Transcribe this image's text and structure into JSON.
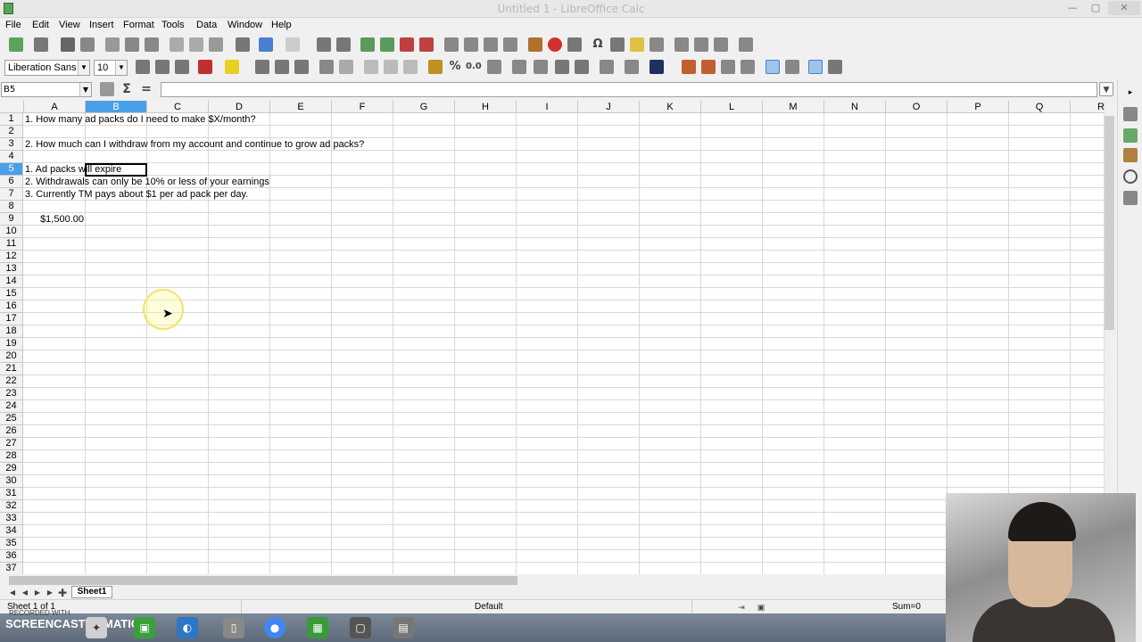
{
  "window": {
    "title": "Untitled 1 - LibreOffice Calc",
    "min": "—",
    "max": "▢",
    "close": "✕"
  },
  "menu": [
    "File",
    "Edit",
    "View",
    "Insert",
    "Format",
    "Tools",
    "Data",
    "Window",
    "Help"
  ],
  "format_bar": {
    "font_name": "Liberation Sans",
    "font_size": "10"
  },
  "formula_bar": {
    "name_box": "B5",
    "input": ""
  },
  "columns": [
    "A",
    "B",
    "C",
    "D",
    "E",
    "F",
    "G",
    "H",
    "I",
    "J",
    "K",
    "L",
    "M",
    "N",
    "O",
    "P",
    "Q",
    "R"
  ],
  "selected_column": "B",
  "rows": [
    "1",
    "2",
    "3",
    "4",
    "5",
    "6",
    "7",
    "8",
    "9",
    "10",
    "11",
    "12",
    "13",
    "14",
    "15",
    "16",
    "17",
    "18",
    "19",
    "20",
    "21",
    "22",
    "23",
    "24",
    "25",
    "26",
    "27",
    "28",
    "29",
    "30",
    "31",
    "32",
    "33",
    "34",
    "35",
    "36",
    "37"
  ],
  "selected_row": "5",
  "cells": {
    "A1": "1. How many ad packs do I need to make $X/month?",
    "A3": "2. How much can I withdraw from my account and continue to grow ad packs?",
    "A5": "1. Ad packs will expire",
    "A6": "2. Withdrawals can only be 10% or less of your earnings",
    "A7": "3. Currently TM pays about $1 per ad pack per day.",
    "A9": "$1,500.00"
  },
  "sheet_tabs": [
    "Sheet1"
  ],
  "status": {
    "sheet_info": "Sheet 1 of 1",
    "page_style": "Default",
    "sum": "Sum=0"
  },
  "taskbar": {
    "screencast_label": "SCREENCAST",
    "matic_label": "MATIC",
    "recorded_with": "RECORDED WITH"
  }
}
